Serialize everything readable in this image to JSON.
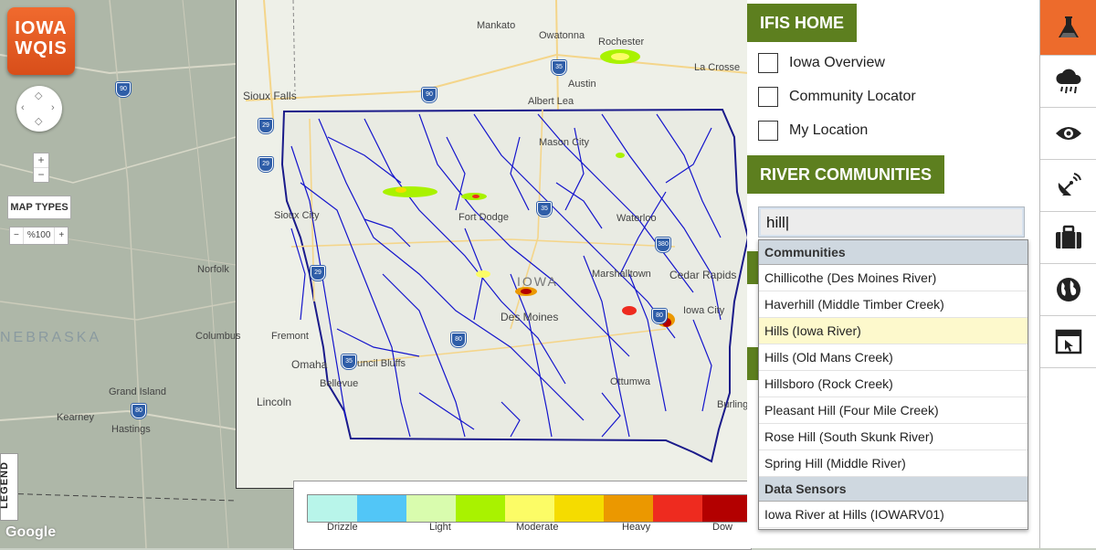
{
  "logo": {
    "line1": "IOWA",
    "line2": "WQIS"
  },
  "map_controls": {
    "zoom_in": "+",
    "zoom_out": "−",
    "map_types": "MAP TYPES",
    "opacity_minus": "−",
    "opacity_value": "%100",
    "opacity_plus": "+",
    "legend": "LEGEND",
    "google": "Google"
  },
  "map_labels": {
    "sioux_falls": "Sioux Falls",
    "mankato": "Mankato",
    "owatonna": "Owatonna",
    "rochester": "Rochester",
    "la_crosse": "La Crosse",
    "austin": "Austin",
    "albert_lea": "Albert Lea",
    "mason_city": "Mason City",
    "sioux_city": "Sioux City",
    "fort_dodge": "Fort Dodge",
    "waterloo": "Waterloo",
    "iowa": "IOWA",
    "marshalltown": "Marshalltown",
    "cedar_rapids": "Cedar Rapids",
    "iowa_city": "Iowa City",
    "des_moines": "Des Moines",
    "norfolk": "Norfolk",
    "nebraska": "NEBRASKA",
    "columbus": "Columbus",
    "fremont": "Fremont",
    "omaha": "Omaha",
    "council_bluffs": "Council Bluffs",
    "bellevue": "Bellevue",
    "ottumwa": "Ottumwa",
    "burlington": "Burling",
    "lincoln": "Lincoln",
    "grand_island": "Grand Island",
    "kearney": "Kearney",
    "hastings": "Hastings"
  },
  "highway_shields": [
    "90",
    "29",
    "35",
    "90",
    "29",
    "35",
    "29",
    "380",
    "80",
    "35",
    "80",
    "80",
    "80"
  ],
  "precip_scale": {
    "colors": [
      "#b8f5ea",
      "#52c6f7",
      "#d9fcae",
      "#a9f200",
      "#fcfc66",
      "#f5dc00",
      "#eb9800",
      "#ee2b1f",
      "#b30000"
    ],
    "labels": [
      "Drizzle",
      "Light",
      "Moderate",
      "Heavy",
      "Dow"
    ]
  },
  "panel": {
    "ifis_home": "IFIS HOME",
    "options": [
      "Iowa Overview",
      "Community Locator",
      "My Location"
    ],
    "river_communities": "RIVER COMMUNITIES",
    "search_value": "hill",
    "dropdown": {
      "communities_header": "Communities",
      "communities": [
        "Chillicothe (Des Moines River)",
        "Haverhill (Middle Timber Creek)",
        "Hills (Iowa River)",
        "Hills (Old Mans Creek)",
        "Hillsboro (Rock Creek)",
        "Pleasant Hill (Four Mile Creek)",
        "Rose Hill (South Skunk River)",
        "Spring Hill (Middle River)"
      ],
      "selected_index": 2,
      "sensors_header": "Data Sensors",
      "sensors": [
        "Iowa River at Hills (IOWARV01)"
      ]
    }
  },
  "rail": {
    "items": [
      "flask-icon",
      "rain-cloud-icon",
      "eye-icon",
      "satellite-dish-icon",
      "briefcase-icon",
      "globe-icon",
      "window-cursor-icon"
    ],
    "active": "flask-icon",
    "accent": "#ed6b2c",
    "brand_green": "#5d7f1f"
  }
}
